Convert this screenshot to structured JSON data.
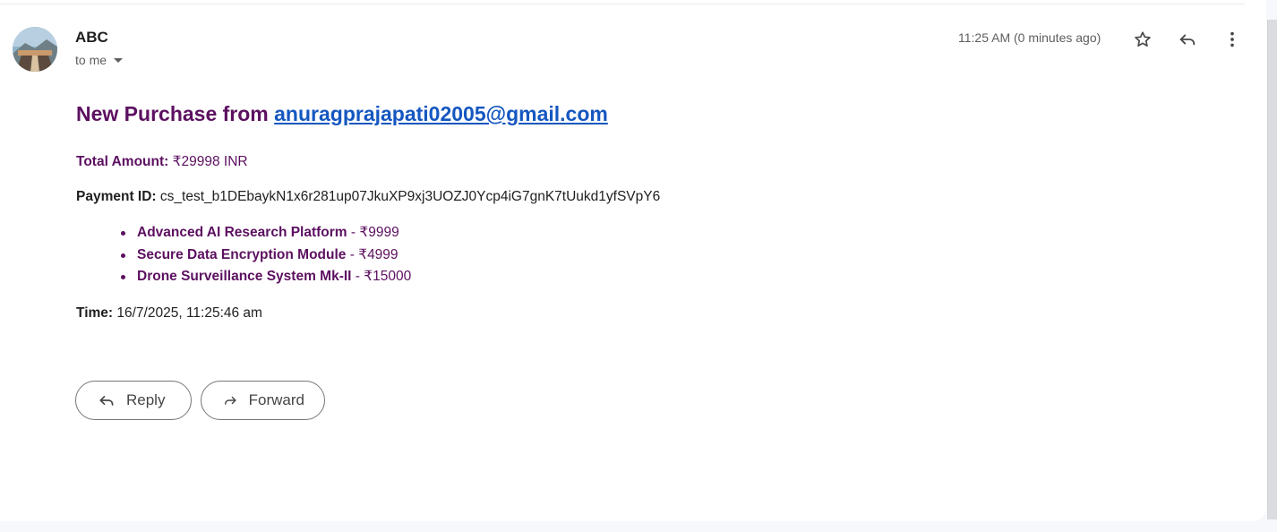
{
  "sender": {
    "name": "ABC",
    "recipient_label": "to me"
  },
  "header": {
    "timestamp": "11:25 AM (0 minutes ago)"
  },
  "icons": {
    "star": "star-icon",
    "reply": "reply-icon",
    "more": "more-vert-icon",
    "caret": "chevron-down-icon",
    "forward": "forward-icon"
  },
  "email": {
    "subject_prefix": "New Purchase from",
    "subject_email": "anuragprajapati02005@gmail.com",
    "total_label": "Total Amount:",
    "total_value": "₹29998 INR",
    "payment_label": "Payment ID:",
    "payment_value": "cs_test_b1DEbaykN1x6r281up07JkuXP9xj3UOZJ0Ycp4iG7gnK7tUukd1yfSVpY6",
    "items": [
      {
        "name": "Advanced AI Research Platform",
        "price": "- ₹9999"
      },
      {
        "name": "Secure Data Encryption Module",
        "price": "- ₹4999"
      },
      {
        "name": "Drone Surveillance System Mk-II",
        "price": "- ₹15000"
      }
    ],
    "time_label": "Time:",
    "time_value": "16/7/2025, 11:25:46 am"
  },
  "actions": {
    "reply_label": "Reply",
    "forward_label": "Forward"
  },
  "colors": {
    "accent_purple": "#5c1060",
    "link_blue": "#1557c0"
  }
}
